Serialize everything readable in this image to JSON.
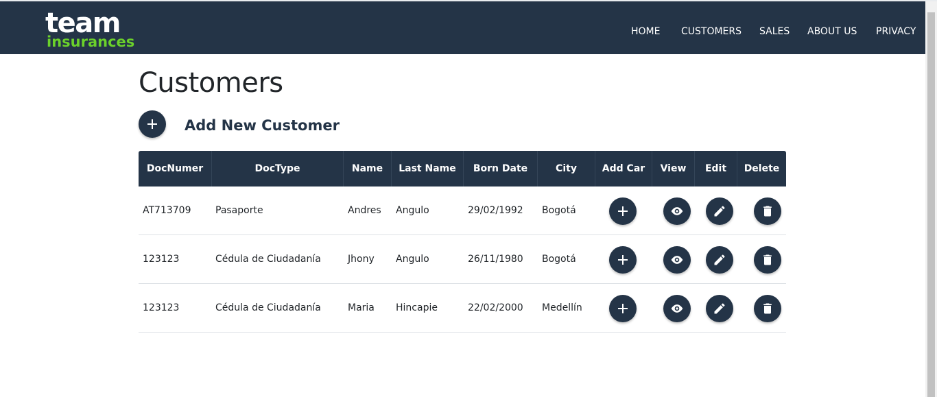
{
  "brand": {
    "line1": "team",
    "line2": "insurances"
  },
  "nav": {
    "items": [
      "HOME",
      "CUSTOMERS",
      "SALES",
      "ABOUT US",
      "PRIVACY"
    ]
  },
  "page": {
    "title": "Customers",
    "add_label": "Add New Customer"
  },
  "table": {
    "headers": [
      "DocNumer",
      "DocType",
      "Name",
      "Last Name",
      "Born Date",
      "City",
      "Add Car",
      "View",
      "Edit",
      "Delete"
    ],
    "rows": [
      [
        "AT713709",
        "Pasaporte",
        "Andres",
        "Angulo",
        "29/02/1992",
        "Bogotá"
      ],
      [
        "123123",
        "Cédula de Ciudadanía",
        "Jhony",
        "Angulo",
        "26/11/1980",
        "Bogotá"
      ],
      [
        "123123",
        "Cédula de Ciudadanía",
        "Maria",
        "Hincapie",
        "22/02/2000",
        "Medellín"
      ]
    ]
  },
  "icons": {
    "add": "plus-icon",
    "view": "eye-icon",
    "edit": "pencil-icon",
    "delete": "trash-icon"
  },
  "colors": {
    "navbar": "#243447",
    "brand_green": "#6bd12b",
    "button": "#243447"
  }
}
